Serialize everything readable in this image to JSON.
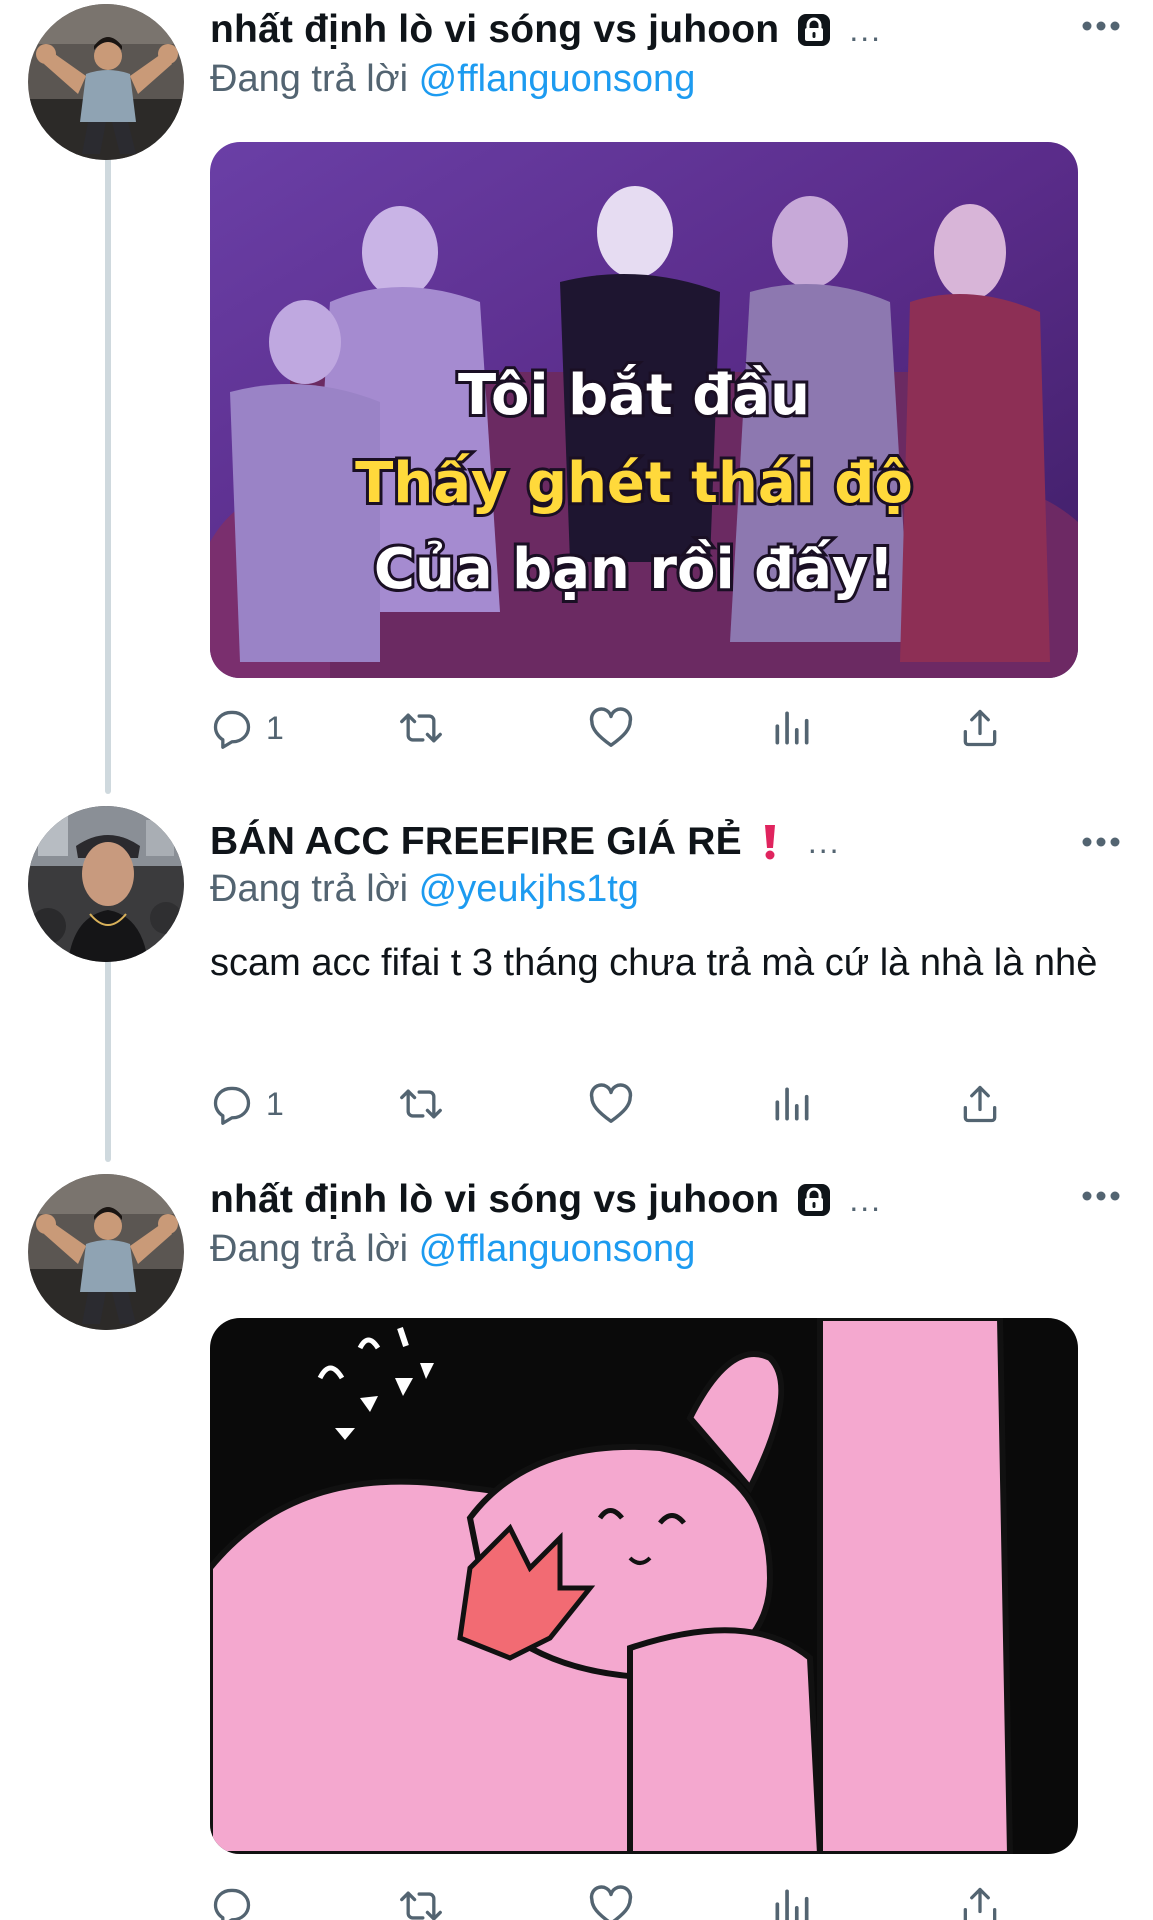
{
  "tweets": [
    {
      "display_name": "nhất định lò vi sóng vs juhoon",
      "badge_icon": "lock-icon",
      "name_overflow": "...",
      "reply_prefix": "Đang trả lời",
      "reply_to": "@fflanguonsong",
      "media": {
        "caption_line_1": "Tôi bắt đầu",
        "caption_line_2": "Thấy ghét thái độ",
        "caption_line_3": "Của bạn rồi đấy!"
      },
      "actions": {
        "reply_count": "1"
      }
    },
    {
      "display_name": "BÁN ACC FREEFIRE GIÁ RẺ",
      "badge_icon": "exclamation-icon",
      "name_overflow": "...",
      "reply_prefix": "Đang trả lời",
      "reply_to": "@yeukjhs1tg",
      "text": "scam acc fifai t 3 tháng chưa trả mà cứ là nhà là nhè",
      "actions": {
        "reply_count": "1"
      }
    },
    {
      "display_name": "nhất định lò vi sóng vs juhoon",
      "badge_icon": "lock-icon",
      "name_overflow": "...",
      "reply_prefix": "Đang trả lời",
      "reply_to": "@fflanguonsong",
      "actions": {
        "reply_count": ""
      }
    }
  ],
  "colors": {
    "text": "#0f1419",
    "secondary": "#536471",
    "link": "#1d9bf0",
    "thread_line": "#cfd9de",
    "caption_yellow": "#ffd93b",
    "alert_red": "#e0245e"
  },
  "icons": [
    "reply-icon",
    "retweet-icon",
    "like-icon",
    "views-icon",
    "share-icon",
    "more-icon"
  ]
}
